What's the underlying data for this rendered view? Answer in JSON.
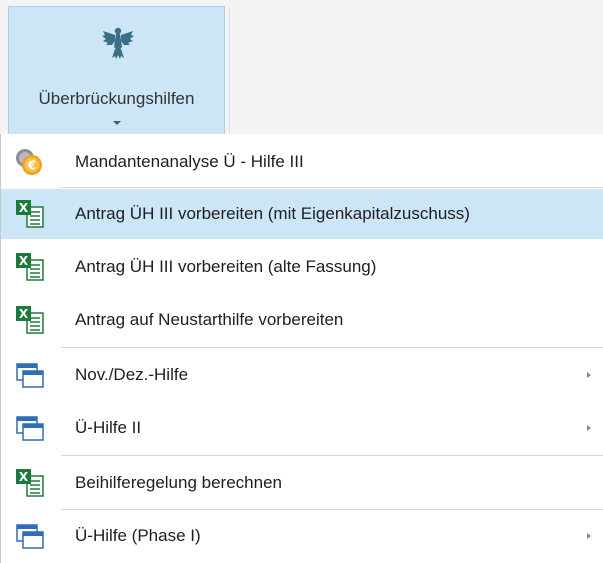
{
  "ribbon": {
    "button_label": "Überbrückungshilfen",
    "icon": "federal-eagle-icon"
  },
  "menu": {
    "items": [
      {
        "label": "Mandantenanalyse Ü - Hilfe III",
        "icon": "coin-euro-icon",
        "submenu": false,
        "highlighted": false
      },
      {
        "label": "Antrag ÜH III vorbereiten (mit Eigenkapitalzuschuss)",
        "icon": "excel-form-icon",
        "submenu": false,
        "highlighted": true
      },
      {
        "label": "Antrag ÜH III vorbereiten (alte Fassung)",
        "icon": "excel-form-icon",
        "submenu": false,
        "highlighted": false
      },
      {
        "label": "Antrag auf Neustarthilfe vorbereiten",
        "icon": "excel-form-icon",
        "submenu": false,
        "highlighted": false
      },
      {
        "label": "Nov./Dez.-Hilfe",
        "icon": "windows-icon",
        "submenu": true,
        "highlighted": false
      },
      {
        "label": "Ü-Hilfe II",
        "icon": "windows-icon",
        "submenu": true,
        "highlighted": false
      },
      {
        "label": "Beihilferegelung berechnen",
        "icon": "excel-form-icon",
        "submenu": false,
        "highlighted": false
      },
      {
        "label": "Ü-Hilfe (Phase I)",
        "icon": "windows-icon",
        "submenu": true,
        "highlighted": false
      }
    ]
  },
  "colors": {
    "highlight": "#cde6f7",
    "excel_green": "#1e7a3c",
    "window_blue": "#2f6db5"
  }
}
